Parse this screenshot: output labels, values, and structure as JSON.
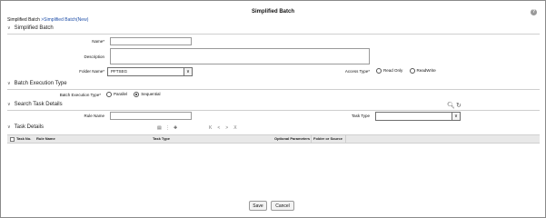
{
  "window": {
    "title": "Simplified Batch",
    "help_icon": "?"
  },
  "breadcrumb": {
    "root": "Simplified Batch",
    "separator": " >",
    "current": "Simplified Batch(New)"
  },
  "sections": {
    "simplified_batch": "Simplified Batch",
    "batch_execution_type": "Batch Execution Type",
    "search_task_details": "Search Task Details",
    "task_details": "Task Details"
  },
  "form": {
    "name_label": "Name*",
    "name_value": "",
    "description_label": "Description",
    "description_value": "",
    "folder_label": "Folder Name*",
    "folder_value": "PFTSEG",
    "access_type_label": "Access Type*",
    "access_type_options": [
      "Read Only",
      "ReadWrite"
    ],
    "access_type_selected": "",
    "batch_execution_label": "Batch Execution Type*",
    "batch_execution_options": [
      "Parallel",
      "Sequential"
    ],
    "batch_execution_selected": "Sequential"
  },
  "search": {
    "rule_name_label": "Rule Name",
    "rule_name_value": "",
    "task_type_label": "Task Type",
    "task_type_value": ""
  },
  "task_grid": {
    "columns": [
      "Task No.",
      "Rule Name",
      "Task Type",
      "Optional Parameters",
      "Folder or Source"
    ],
    "rows": []
  },
  "pager": {
    "first": "K",
    "prev": "<",
    "next": ">",
    "last": "X"
  },
  "icons": {
    "search": "search-icon",
    "reset": "refresh-icon",
    "chevron": "chevron-down-icon"
  },
  "buttons": {
    "save": "Save",
    "cancel": "Cancel"
  }
}
